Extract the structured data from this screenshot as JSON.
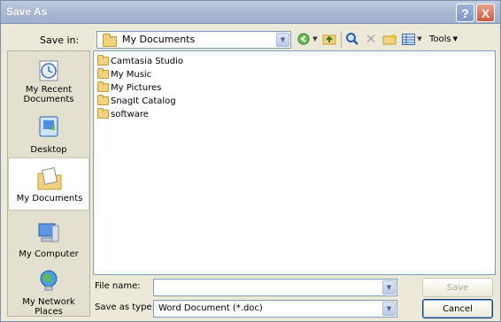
{
  "window": {
    "title": "Save As",
    "help_label": "?",
    "close_label": "X"
  },
  "save_in": {
    "label": "Save in:",
    "value": "My Documents"
  },
  "toolbar": {
    "back_icon": "back-arrow-icon",
    "up_icon": "up-folder-icon",
    "search_icon": "search-web-icon",
    "delete_icon": "delete-x-icon",
    "new_folder_icon": "new-folder-icon",
    "views_icon": "views-icon",
    "tools_label": "Tools"
  },
  "places": [
    {
      "label": "My Recent Documents",
      "icon": "recent-documents-icon"
    },
    {
      "label": "Desktop",
      "icon": "desktop-icon"
    },
    {
      "label": "My Documents",
      "icon": "my-documents-icon",
      "selected": true
    },
    {
      "label": "My Computer",
      "icon": "my-computer-icon"
    },
    {
      "label": "My Network Places",
      "icon": "network-places-icon"
    }
  ],
  "files": [
    {
      "name": "Camtasia Studio"
    },
    {
      "name": "My Music"
    },
    {
      "name": "My Pictures"
    },
    {
      "name": "SnagIt Catalog"
    },
    {
      "name": "software"
    }
  ],
  "file_name": {
    "label": "File name:",
    "value": ""
  },
  "save_as_type": {
    "label": "Save as type:",
    "value": "Word Document (*.doc)"
  },
  "buttons": {
    "save": "Save",
    "cancel": "Cancel"
  },
  "colors": {
    "title_bar": "#a9b8d2",
    "dialog_bg": "#ece9d8",
    "field_border": "#7f9db9"
  }
}
